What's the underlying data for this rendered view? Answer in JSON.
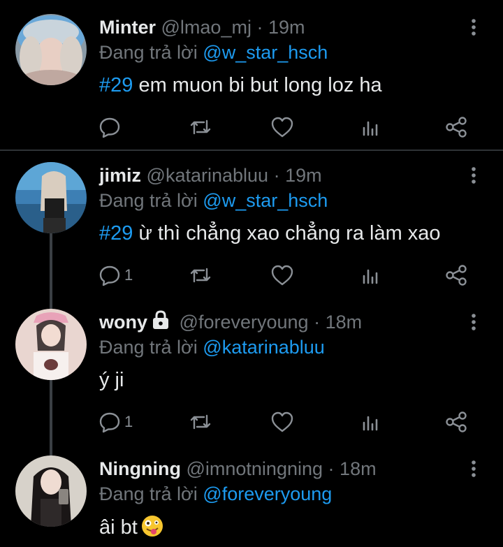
{
  "reply_prefix": "Đang trả lời",
  "colors": {
    "background": "#000000",
    "text": "#e7e9ea",
    "muted": "#71767b",
    "link": "#1d9bf0",
    "divider": "#2f3336",
    "thread_line": "#3a3f44"
  },
  "tweets": [
    {
      "name": "Minter",
      "handle": "@lmao_mj",
      "time": "19m",
      "replying_to": "@w_star_hsch",
      "hashtag": "#29",
      "text": " em muon bi but long loz ha",
      "reply_count": ""
    },
    {
      "name": "jimiz",
      "handle": "@katarinabluu",
      "time": "19m",
      "replying_to": "@w_star_hsch",
      "hashtag": "#29",
      "text": " ừ thì chẳng xao chẳng ra làm xao",
      "reply_count": "1"
    },
    {
      "name": "wony",
      "handle": "@foreveryoung",
      "time": "18m",
      "replying_to": "@katarinabluu",
      "hashtag": "",
      "text": "ý ji",
      "reply_count": "1",
      "protected": true
    },
    {
      "name": "Ningning",
      "handle": "@imnotningning",
      "time": "18m",
      "replying_to": "@foreveryoung",
      "hashtag": "",
      "text": "âi bt",
      "emoji": "zany-face",
      "reply_count": ""
    }
  ],
  "icons": {
    "reply": "comment-icon",
    "retweet": "retweet-icon",
    "like": "heart-icon",
    "analytics": "analytics-icon",
    "share": "share-icon",
    "more": "more-vertical-icon",
    "lock": "lock-icon"
  }
}
